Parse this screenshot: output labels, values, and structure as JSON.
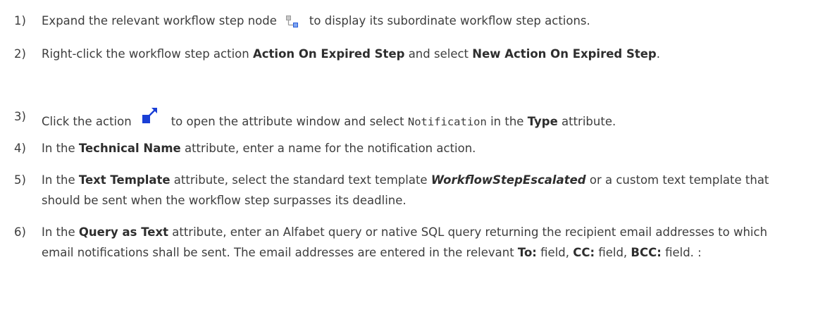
{
  "steps": [
    {
      "num": "1)",
      "t1": "Expand the relevant workflow step node",
      "icon": "workflow-step-node-icon",
      "t2": "to display its subordinate workflow step actions."
    },
    {
      "num": "2)",
      "t1": "Right-click the workflow step action ",
      "b1": "Action On Expired Step",
      "t2": " and select ",
      "b2": "New Action On Expired Step",
      "t3": "."
    },
    {
      "num": "3)",
      "t1": "Click the action",
      "icon": "action-edit-icon",
      "t2": "to open the attribute window and select ",
      "code": "Notification",
      "t3": " in the ",
      "b1": "Type",
      "t4": " attribute."
    },
    {
      "num": "4)",
      "t1": "In the ",
      "b1": "Technical Name",
      "t2": " attribute, enter a name for the notification action."
    },
    {
      "num": "5)",
      "t1": "In the ",
      "b1": "Text Template",
      "t2": " attribute, select the standard text template ",
      "bi1": "WorkflowStepEscalated",
      "t3": " or a custom text template that should be sent when the workflow step surpasses its deadline."
    },
    {
      "num": "6)",
      "t1": "In the ",
      "b1": "Query as Text",
      "t2": " attribute, enter an Alfabet query or native SQL query returning the recipient email addresses to which email notifications shall be sent. The email addresses are entered in the relevant ",
      "b2": "To:",
      "t3": " field, ",
      "b3": "CC:",
      "t4": " field, ",
      "b4": "BCC:",
      "t5": " field. :"
    }
  ],
  "colors": {
    "text": "#3d3d3d",
    "icon_blue": "#1a3fd6",
    "icon_gray": "#8a8a8a"
  }
}
